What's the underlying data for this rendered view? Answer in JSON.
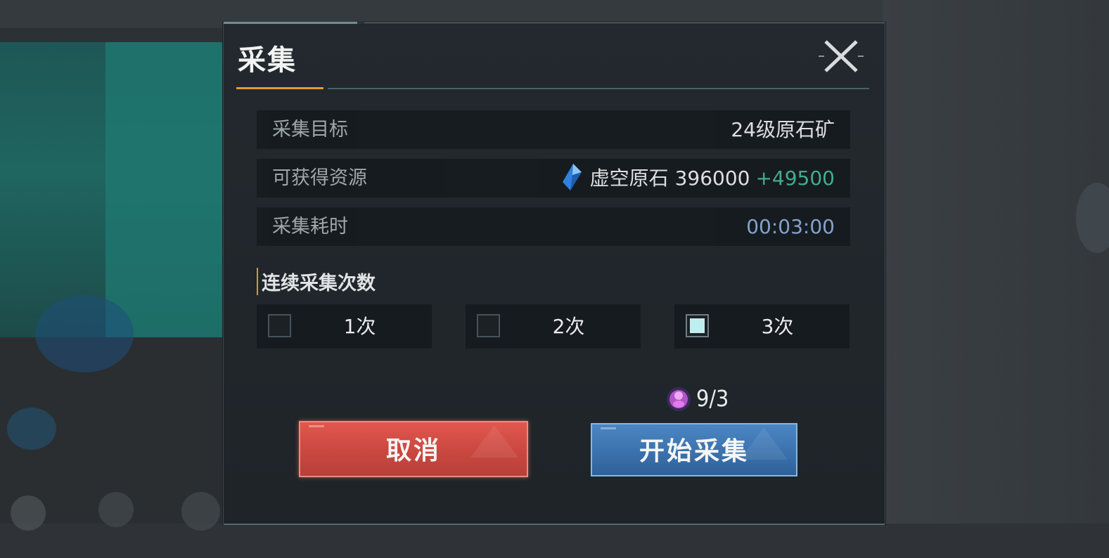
{
  "dialog": {
    "title": "采集",
    "close_icon": "close-x-icon"
  },
  "info_rows": [
    {
      "label": "采集目标",
      "value": "24级原石矿"
    },
    {
      "label": "可获得资源",
      "resource_icon": "void-crystal-icon",
      "resource_name": "虚空原石",
      "amount": "396000",
      "bonus": "+49500"
    },
    {
      "label": "采集耗时",
      "value": "00:03:00"
    }
  ],
  "repeat_section": {
    "label": "连续采集次数",
    "options": [
      {
        "label": "1次",
        "checked": false
      },
      {
        "label": "2次",
        "checked": false
      },
      {
        "label": "3次",
        "checked": true
      }
    ]
  },
  "stamina": {
    "icon": "stamina-orb-icon",
    "count": "9/3"
  },
  "buttons": {
    "cancel": "取消",
    "start": "开始采集"
  },
  "colors": {
    "accent_orange": "#e39b2d",
    "bonus_green": "#42b58f",
    "time_blue": "#8aa9d4",
    "cancel_red": "#d24d45",
    "start_blue": "#3f79b6"
  }
}
